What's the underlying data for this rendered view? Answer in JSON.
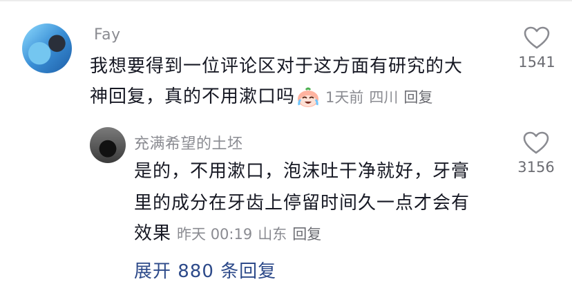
{
  "comment": {
    "username": "Fay",
    "text_line1": "我想要得到一位评论区对于这方面有研究的大",
    "text_line2": "神回复，真的不用漱口吗",
    "emoji": "crying-laughing-face-emoji",
    "time": "1天前",
    "location": "四川",
    "reply_label": "回复",
    "likes": "1541"
  },
  "reply": {
    "username": "充满希望的土坯",
    "text_line1": "是的，不用漱口，泡沫吐干净就好，牙膏",
    "text_line2": "里的成分在牙齿上停留时间久一点才会有",
    "text_line3": "效果",
    "time": "昨天 00:19",
    "location": "山东",
    "reply_label": "回复",
    "likes": "3156"
  },
  "expand_label": "展开 880 条回复",
  "colors": {
    "text": "#161823",
    "meta": "#8a8b91",
    "link": "#2d4a8a"
  }
}
